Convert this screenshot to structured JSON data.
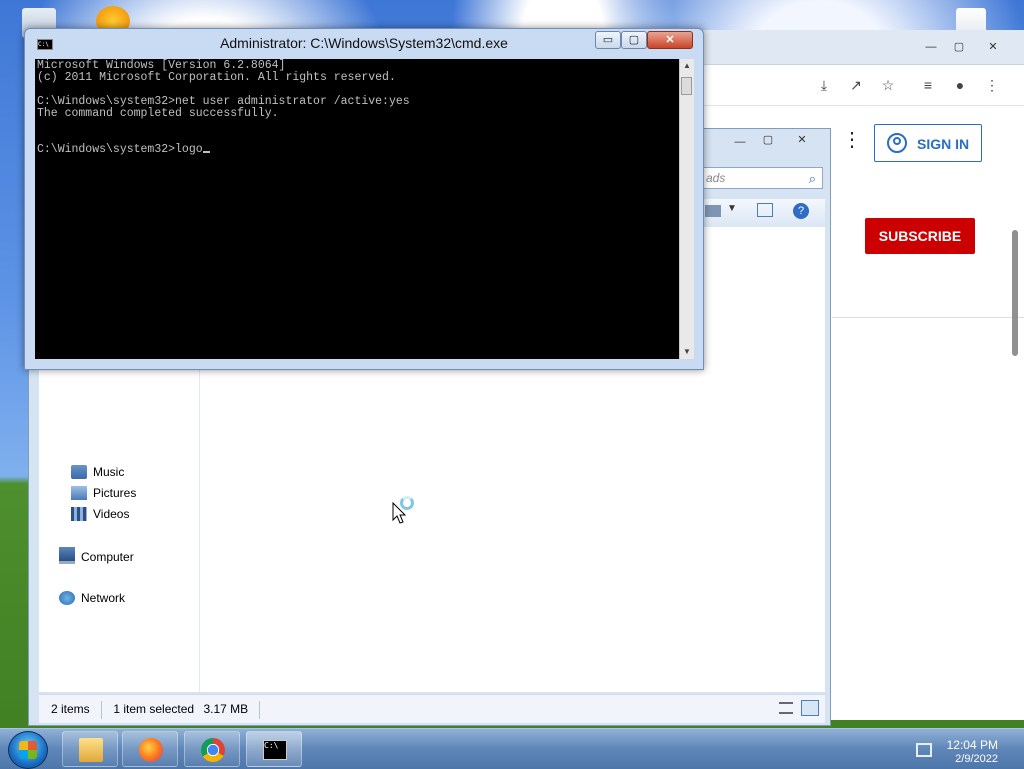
{
  "cmd": {
    "title": "Administrator: C:\\Windows\\System32\\cmd.exe",
    "icon_label": "C:\\",
    "lines": [
      "Microsoft Windows [Version 6.2.8064]",
      "(c) 2011 Microsoft Corporation. All rights reserved.",
      "",
      "C:\\Windows\\system32>net user administrator /active:yes",
      "The command completed successfully.",
      "",
      "C:\\Windows\\system32>logo"
    ],
    "minimize": "▭",
    "maximize": "▢",
    "close": "✕"
  },
  "explorer": {
    "search_placeholder": "ads",
    "nav": [
      {
        "label": "Music",
        "icon": "music-library-icon"
      },
      {
        "label": "Pictures",
        "icon": "pictures-library-icon"
      },
      {
        "label": "Videos",
        "icon": "videos-library-icon"
      },
      {
        "label": "Computer",
        "icon": "computer-icon"
      },
      {
        "label": "Network",
        "icon": "network-icon"
      }
    ],
    "status": {
      "items": "2 items",
      "selected": "1 item selected",
      "size": "3.17 MB"
    }
  },
  "browser": {
    "sign_in": "SIGN IN",
    "subscribe": "SUBSCRIBE"
  },
  "taskbar": {
    "apps": [
      "file-explorer",
      "firefox",
      "chrome",
      "command-prompt"
    ],
    "clock_time": "12:04 PM",
    "clock_date": "2/9/2022"
  },
  "colors": {
    "subscribe_red": "#cc0000",
    "signin_blue": "#2a6ec4",
    "console_bg": "#000000",
    "console_fg": "#c0c0c0"
  }
}
